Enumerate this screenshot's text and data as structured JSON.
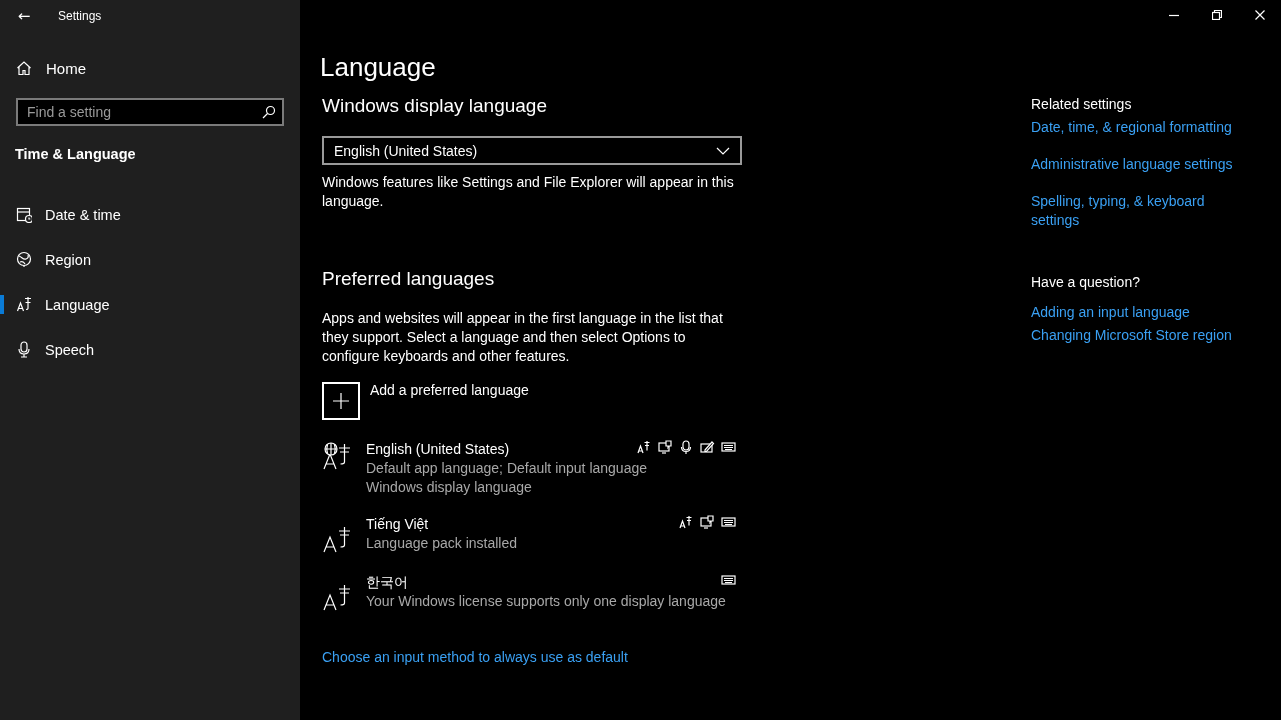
{
  "window": {
    "title": "Settings",
    "back": "←",
    "controls": [
      {
        "kind": "minimize"
      },
      {
        "kind": "restore"
      },
      {
        "kind": "close"
      }
    ]
  },
  "sidebar": {
    "home": "Home",
    "search": {
      "placeholder": "Find a setting"
    },
    "section": "Time & Language",
    "items": [
      {
        "label": "Date & time",
        "kind": "date",
        "selected": false
      },
      {
        "label": "Region",
        "kind": "region",
        "selected": false
      },
      {
        "label": "Language",
        "kind": "language",
        "selected": true
      },
      {
        "label": "Speech",
        "kind": "speech",
        "selected": false
      }
    ]
  },
  "page": {
    "title": "Language",
    "display_heading": "Windows display language",
    "display_select": {
      "value": "English (United States)"
    },
    "display_note": "Windows features like Settings and File Explorer will appear in this language.",
    "preferred_heading": "Preferred languages",
    "preferred_note": "Apps and websites will appear in the first language in the list that they support. Select a language and then select Options to configure keyboards and other features.",
    "add_button": "Add a preferred language",
    "languages": [
      {
        "name": "English (United States)",
        "details": [
          "Default app language; Default input language",
          "Windows display language"
        ],
        "display_language": true,
        "features": [
          {
            "kind": "language-pack"
          },
          {
            "kind": "text-to-speech"
          },
          {
            "kind": "speech"
          },
          {
            "kind": "handwriting"
          },
          {
            "kind": "keyboard"
          }
        ]
      },
      {
        "name": "Tiếng Việt",
        "details": [
          "Language pack installed"
        ],
        "display_language": false,
        "features": [
          {
            "kind": "language-pack"
          },
          {
            "kind": "text-to-speech"
          },
          {
            "kind": "keyboard"
          }
        ]
      },
      {
        "name": "한국어",
        "details": [
          "Your Windows license supports only one display language"
        ],
        "display_language": false,
        "features": [
          {
            "kind": "keyboard"
          }
        ]
      }
    ],
    "bottom_link": "Choose an input method to always use as default"
  },
  "related": {
    "heading": "Related settings",
    "links": [
      "Date, time, & regional formatting",
      "Administrative language settings",
      "Spelling, typing, & keyboard settings"
    ],
    "question_heading": "Have a question?",
    "help_links": [
      "Adding an input language",
      "Changing Microsoft Store region"
    ]
  }
}
